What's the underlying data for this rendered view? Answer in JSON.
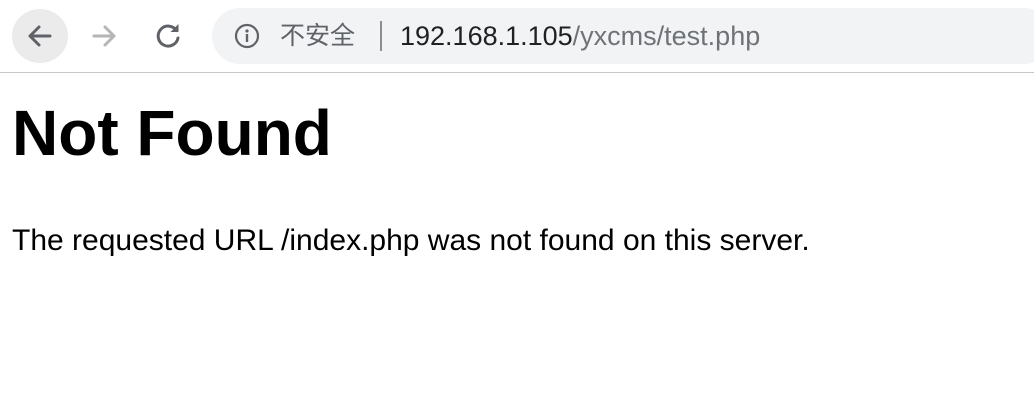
{
  "browser": {
    "security_label": "不安全",
    "url_host": "192.168.1.105",
    "url_path": "/yxcms/test.php",
    "icons": {
      "back": "arrow-left-icon",
      "forward": "arrow-right-icon",
      "reload": "reload-icon",
      "info": "info-icon"
    }
  },
  "page": {
    "heading": "Not Found",
    "message": "The requested URL /index.php was not found on this server."
  }
}
